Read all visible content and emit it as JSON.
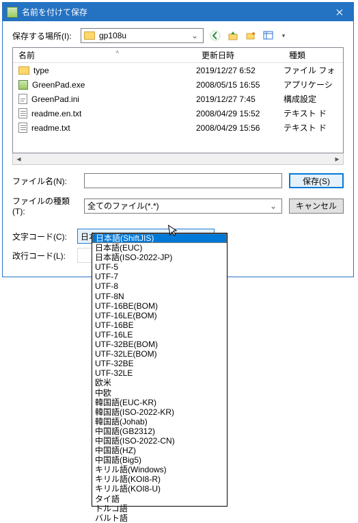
{
  "titlebar": {
    "title": "名前を付けて保存"
  },
  "location": {
    "label": "保存する場所(I):",
    "value": "gp108u"
  },
  "toolbar_icons": {
    "back": "back-icon",
    "up": "up-one-level-icon",
    "new_folder": "new-folder-icon",
    "views": "views-icon"
  },
  "filelist": {
    "cols": {
      "name": "名前",
      "date": "更新日時",
      "type": "種類"
    },
    "rows": [
      {
        "name": "type",
        "date": "2019/12/27 6:52",
        "type": "ファイル フォ",
        "icon": "folder"
      },
      {
        "name": "GreenPad.exe",
        "date": "2008/05/15 16:55",
        "type": "アプリケーシ",
        "icon": "exe"
      },
      {
        "name": "GreenPad.ini",
        "date": "2019/12/27 7:45",
        "type": "構成設定",
        "icon": "ini"
      },
      {
        "name": "readme.en.txt",
        "date": "2008/04/29 15:52",
        "type": "テキスト ド",
        "icon": "txt"
      },
      {
        "name": "readme.txt",
        "date": "2008/04/29 15:56",
        "type": "テキスト ド",
        "icon": "txt"
      }
    ]
  },
  "filename": {
    "label": "ファイル名(N):",
    "value": ""
  },
  "filetype": {
    "label": "ファイルの種類(T):",
    "value": "全てのファイル(*.*)"
  },
  "encoding": {
    "label": "文字コード(C):",
    "value": "日本語(ShiftJIS)"
  },
  "linebreak": {
    "label": "改行コード(L):",
    "value": ""
  },
  "buttons": {
    "save": "保存(S)",
    "cancel": "キャンセル"
  },
  "encoding_options": [
    "日本語(ShiftJIS)",
    "日本語(EUC)",
    "日本語(ISO-2022-JP)",
    "UTF-5",
    "UTF-7",
    "UTF-8",
    "UTF-8N",
    "UTF-16BE(BOM)",
    "UTF-16LE(BOM)",
    "UTF-16BE",
    "UTF-16LE",
    "UTF-32BE(BOM)",
    "UTF-32LE(BOM)",
    "UTF-32BE",
    "UTF-32LE",
    "欧米",
    "中欧",
    "韓国語(EUC-KR)",
    "韓国語(ISO-2022-KR)",
    "韓国語(Johab)",
    "中国語(GB2312)",
    "中国語(ISO-2022-CN)",
    "中国語(HZ)",
    "中国語(Big5)",
    "キリル語(Windows)",
    "キリル語(KOI8-R)",
    "キリル語(KOI8-U)",
    "タイ語",
    "トルコ語",
    "バルト語"
  ],
  "encoding_selected_index": 0
}
